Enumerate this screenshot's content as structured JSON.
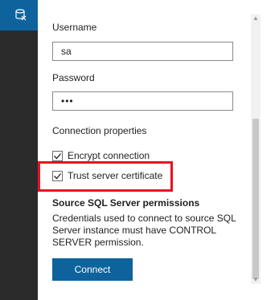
{
  "activity_bar": {
    "active_icon": "database-connection-icon"
  },
  "form": {
    "username_label": "Username",
    "username_value": "sa",
    "password_label": "Password",
    "password_value": "•••",
    "connection_properties_label": "Connection properties",
    "encrypt_connection_label": "Encrypt connection",
    "encrypt_connection_checked": true,
    "trust_server_certificate_label": "Trust server certificate",
    "trust_server_certificate_checked": true,
    "permissions_title": "Source SQL Server permissions",
    "permissions_description": "Credentials used to connect to source SQL Server instance must have CONTROL SERVER permission.",
    "connect_label": "Connect"
  },
  "colors": {
    "accent": "#0e639c",
    "highlight": "#e81123",
    "activity_bar": "#2b2b2b"
  }
}
